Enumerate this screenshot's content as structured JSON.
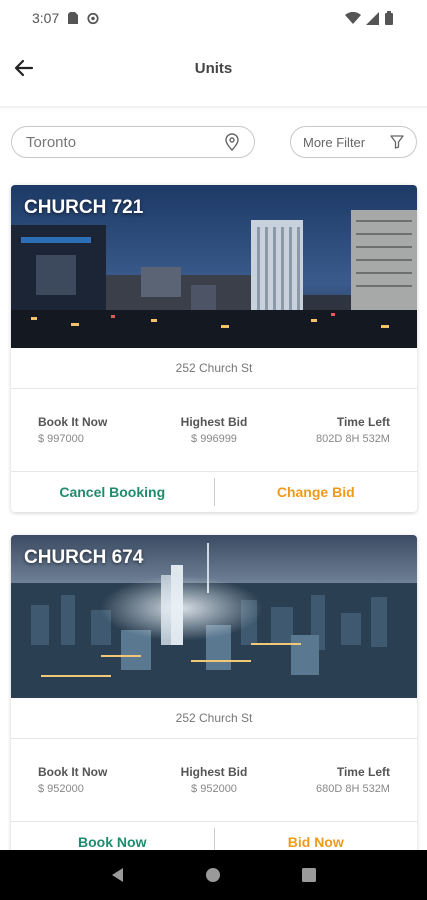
{
  "status_bar": {
    "time": "3:07"
  },
  "app_bar": {
    "title": "Units"
  },
  "search": {
    "value": "Toronto"
  },
  "more_filter": {
    "label": "More Filter"
  },
  "units": [
    {
      "title": "CHURCH 721",
      "address": "252 Church St",
      "book_label": "Book It Now",
      "book_value": "$ 997000",
      "bid_label": "Highest Bid",
      "bid_value": "$ 996999",
      "time_label": "Time Left",
      "time_value": "802D 8H 532M",
      "action_left": "Cancel Booking",
      "action_right": "Change Bid"
    },
    {
      "title": "CHURCH 674",
      "address": "252 Church St",
      "book_label": "Book It Now",
      "book_value": "$ 952000",
      "bid_label": "Highest Bid",
      "bid_value": "$ 952000",
      "time_label": "Time Left",
      "time_value": "680D 8H 532M",
      "action_left": "Book Now",
      "action_right": "Bid Now"
    }
  ],
  "colors": {
    "accent_green": "#1f8c6f",
    "accent_orange": "#f09a1c"
  }
}
